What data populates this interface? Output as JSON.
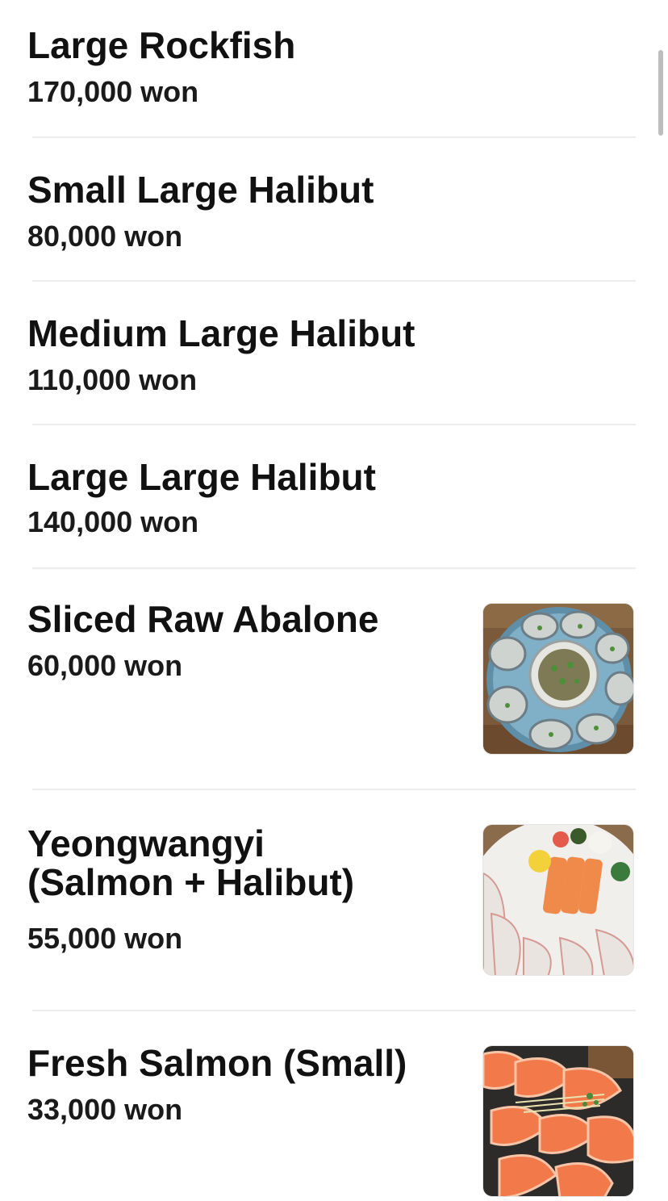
{
  "menu": {
    "items": [
      {
        "name": "Large Rockfish",
        "price": "170,000 won"
      },
      {
        "name": "Small Large Halibut",
        "price": "80,000 won"
      },
      {
        "name": "Medium Large Halibut",
        "price": "110,000 won"
      },
      {
        "name": "Large Large Halibut",
        "price": "140,000 won"
      },
      {
        "name": "Sliced Raw Abalone",
        "price": "60,000 won",
        "image": "abalone-platter-photo"
      },
      {
        "name": "Yeongwangyi\n(Salmon + Halibut)",
        "price": "55,000 won",
        "image": "salmon-halibut-sashimi-photo"
      },
      {
        "name": "Fresh Salmon (Small)",
        "price": "33,000 won",
        "image": "salmon-sashimi-photo"
      }
    ]
  }
}
